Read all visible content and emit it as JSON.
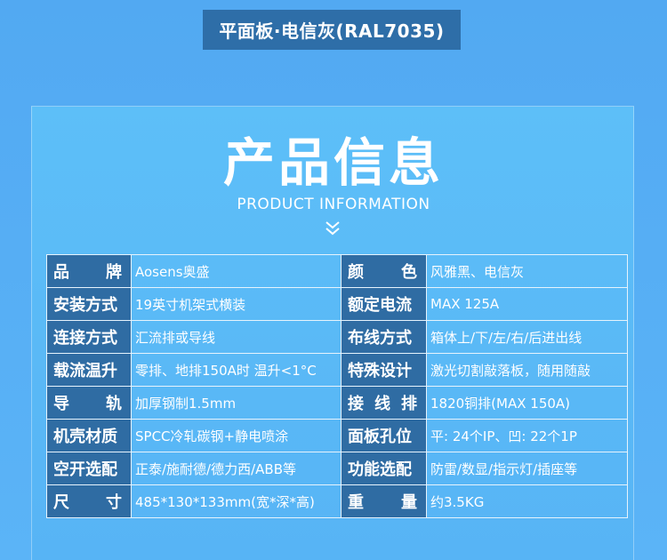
{
  "header": {
    "badge": "平面板·电信灰(RAL7035)"
  },
  "panel": {
    "title": "产品信息",
    "subtitle": "PRODUCT INFORMATION",
    "chevron_icon": "double-chevron-down-icon"
  },
  "specs": [
    {
      "l1": [
        "品",
        "牌"
      ],
      "v1": "Aosens奥盛",
      "l2": [
        "颜",
        "色"
      ],
      "v2": "风雅黑、电信灰"
    },
    {
      "l1": [
        "安装方式"
      ],
      "v1": "19英寸机架式横装",
      "l2": [
        "额定电流"
      ],
      "v2": "MAX 125A"
    },
    {
      "l1": [
        "连接方式"
      ],
      "v1": "汇流排或导线",
      "l2": [
        "布线方式"
      ],
      "v2": "箱体上/下/左/右/后进出线"
    },
    {
      "l1": [
        "载流温升"
      ],
      "v1": "零排、地排150A时 温升<1°C",
      "l2": [
        "特殊设计"
      ],
      "v2": "激光切割敲落板，随用随敲"
    },
    {
      "l1": [
        "导",
        "轨"
      ],
      "v1": "加厚钢制1.5mm",
      "l2": [
        "接",
        "线",
        "排"
      ],
      "v2": "1820铜排(MAX 150A)"
    },
    {
      "l1": [
        "机壳材质"
      ],
      "v1": "SPCC冷轧碳钢+静电喷涂",
      "l2": [
        "面板孔位"
      ],
      "v2": "平: 24个IP、凹: 22个1P"
    },
    {
      "l1": [
        "空开选配"
      ],
      "v1": "正泰/施耐德/德力西/ABB等",
      "l2": [
        "功能选配"
      ],
      "v2": "防雷/数显/指示灯/插座等"
    },
    {
      "l1": [
        "尺",
        "寸"
      ],
      "v1": "485*130*133mm(宽*深*高)",
      "l2": [
        "重",
        "量"
      ],
      "v2": "约3.5KG"
    }
  ]
}
